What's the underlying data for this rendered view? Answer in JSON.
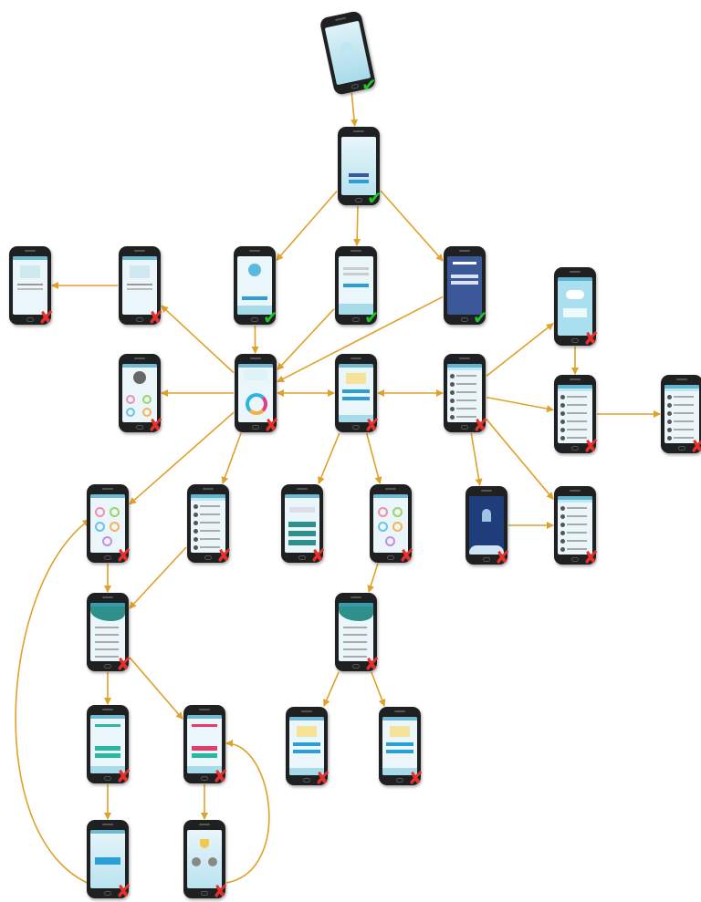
{
  "colors": {
    "edge": "#e0a12a",
    "phone_body": "#1f2022",
    "teal": "#2f8f8a",
    "pass": "#22c425",
    "fail": "#e4312b"
  },
  "marks": {
    "pass_glyph": "✔",
    "fail_glyph": "✘"
  },
  "nodes": [
    {
      "id": "splash",
      "status": "pass",
      "style": "light"
    },
    {
      "id": "home",
      "status": "pass",
      "style": "buttons"
    },
    {
      "id": "sign-up",
      "status": "pass",
      "style": "avatar"
    },
    {
      "id": "login",
      "status": "pass",
      "style": "form"
    },
    {
      "id": "facebook-login",
      "status": "pass",
      "style": "facebook"
    },
    {
      "id": "detail-a",
      "status": "fail",
      "style": "doc"
    },
    {
      "id": "detail-b",
      "status": "fail",
      "style": "doc"
    },
    {
      "id": "profile",
      "status": "fail",
      "style": "profile"
    },
    {
      "id": "dashboard",
      "status": "fail",
      "style": "ring"
    },
    {
      "id": "center-menu",
      "status": "fail",
      "style": "card"
    },
    {
      "id": "friends",
      "status": "fail",
      "style": "list"
    },
    {
      "id": "cloud-intro",
      "status": "fail",
      "style": "cloud"
    },
    {
      "id": "list-a",
      "status": "fail",
      "style": "list"
    },
    {
      "id": "list-b",
      "status": "fail",
      "style": "list"
    },
    {
      "id": "category-grid",
      "status": "fail",
      "style": "grid"
    },
    {
      "id": "contacts",
      "status": "fail",
      "style": "list"
    },
    {
      "id": "teal-buttons",
      "status": "fail",
      "style": "tealbtns"
    },
    {
      "id": "category-grid-2",
      "status": "fail",
      "style": "grid"
    },
    {
      "id": "night-intro",
      "status": "fail",
      "style": "night"
    },
    {
      "id": "list-c",
      "status": "fail",
      "style": "list"
    },
    {
      "id": "wave-menu",
      "status": "fail",
      "style": "wave"
    },
    {
      "id": "wave-menu-2",
      "status": "fail",
      "style": "wave"
    },
    {
      "id": "quiz-a",
      "status": "fail",
      "style": "quiz"
    },
    {
      "id": "quiz-b",
      "status": "fail",
      "style": "quizpink"
    },
    {
      "id": "card-a",
      "status": "fail",
      "style": "card"
    },
    {
      "id": "card-b",
      "status": "fail",
      "style": "card"
    },
    {
      "id": "result-a",
      "status": "fail",
      "style": "result"
    },
    {
      "id": "trophy",
      "status": "fail",
      "style": "trophy"
    }
  ],
  "edges": [
    {
      "from": "splash",
      "to": "home"
    },
    {
      "from": "home",
      "to": "sign-up"
    },
    {
      "from": "home",
      "to": "login"
    },
    {
      "from": "home",
      "to": "facebook-login"
    },
    {
      "from": "sign-up",
      "to": "dashboard"
    },
    {
      "from": "login",
      "to": "dashboard"
    },
    {
      "from": "facebook-login",
      "to": "dashboard"
    },
    {
      "from": "detail-b",
      "to": "detail-a"
    },
    {
      "from": "dashboard",
      "to": "detail-b"
    },
    {
      "from": "dashboard",
      "to": "profile"
    },
    {
      "from": "dashboard",
      "to": "center-menu",
      "bidirectional": true
    },
    {
      "from": "center-menu",
      "to": "friends",
      "bidirectional": true
    },
    {
      "from": "friends",
      "to": "cloud-intro"
    },
    {
      "from": "cloud-intro",
      "to": "list-a"
    },
    {
      "from": "friends",
      "to": "list-a"
    },
    {
      "from": "list-a",
      "to": "list-b"
    },
    {
      "from": "dashboard",
      "to": "category-grid"
    },
    {
      "from": "dashboard",
      "to": "contacts"
    },
    {
      "from": "center-menu",
      "to": "teal-buttons"
    },
    {
      "from": "center-menu",
      "to": "category-grid-2"
    },
    {
      "from": "friends",
      "to": "night-intro"
    },
    {
      "from": "friends",
      "to": "list-c"
    },
    {
      "from": "night-intro",
      "to": "list-c"
    },
    {
      "from": "category-grid",
      "to": "wave-menu"
    },
    {
      "from": "contacts",
      "to": "wave-menu"
    },
    {
      "from": "category-grid-2",
      "to": "wave-menu-2"
    },
    {
      "from": "wave-menu",
      "to": "quiz-a"
    },
    {
      "from": "wave-menu",
      "to": "quiz-b"
    },
    {
      "from": "wave-menu-2",
      "to": "card-a"
    },
    {
      "from": "wave-menu-2",
      "to": "card-b"
    },
    {
      "from": "quiz-a",
      "to": "result-a"
    },
    {
      "from": "quiz-b",
      "to": "trophy"
    },
    {
      "from": "result-a",
      "to": "category-grid",
      "curved": true
    },
    {
      "from": "trophy",
      "to": "quiz-b",
      "curved": true
    }
  ]
}
